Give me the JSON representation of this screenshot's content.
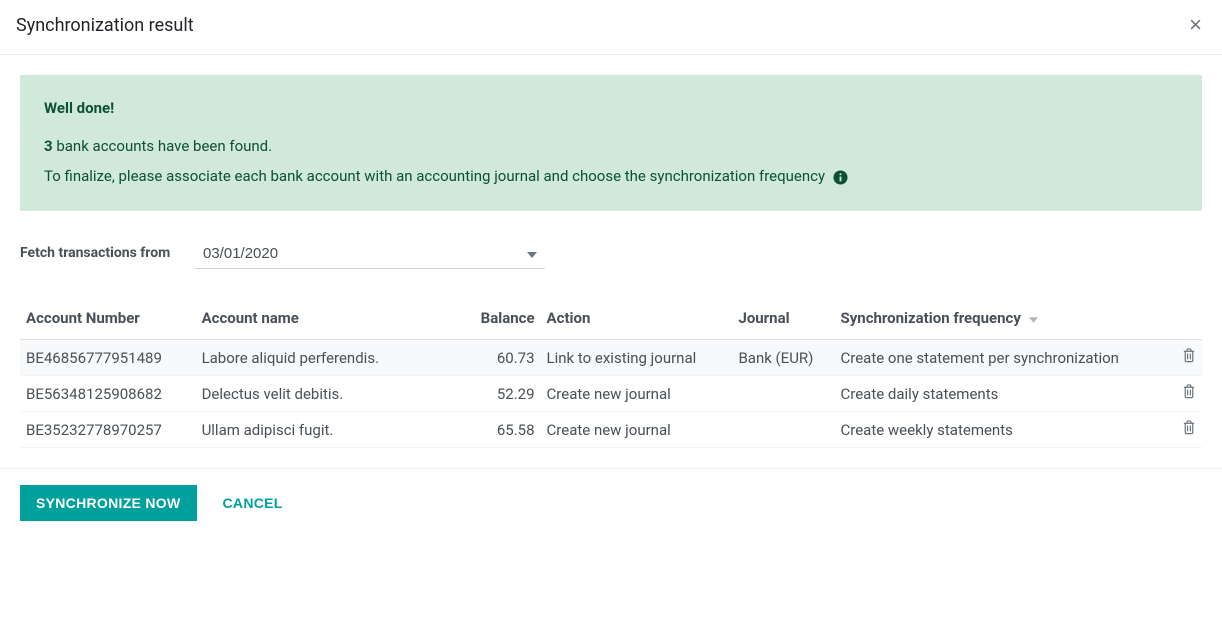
{
  "header": {
    "title": "Synchronization result"
  },
  "alert": {
    "title": "Well done!",
    "count": "3",
    "found_text": "bank accounts have been found.",
    "finalize_text": "To finalize, please associate each bank account with an accounting journal and choose the synchronization frequency"
  },
  "fetch": {
    "label": "Fetch transactions from",
    "value": "03/01/2020"
  },
  "table": {
    "headers": {
      "account_number": "Account Number",
      "account_name": "Account name",
      "balance": "Balance",
      "action": "Action",
      "journal": "Journal",
      "sync_freq": "Synchronization frequency"
    },
    "rows": [
      {
        "account_number": "BE46856777951489",
        "account_name": "Labore aliquid perferendis.",
        "balance": "60.73",
        "action": "Link to existing journal",
        "journal": "Bank (EUR)",
        "sync_freq": "Create one statement per synchronization"
      },
      {
        "account_number": "BE56348125908682",
        "account_name": "Delectus velit debitis.",
        "balance": "52.29",
        "action": "Create new journal",
        "journal": "",
        "sync_freq": "Create daily statements"
      },
      {
        "account_number": "BE35232778970257",
        "account_name": "Ullam adipisci fugit.",
        "balance": "65.58",
        "action": "Create new journal",
        "journal": "",
        "sync_freq": "Create weekly statements"
      }
    ]
  },
  "footer": {
    "sync_now": "Synchronize now",
    "cancel": "Cancel"
  }
}
